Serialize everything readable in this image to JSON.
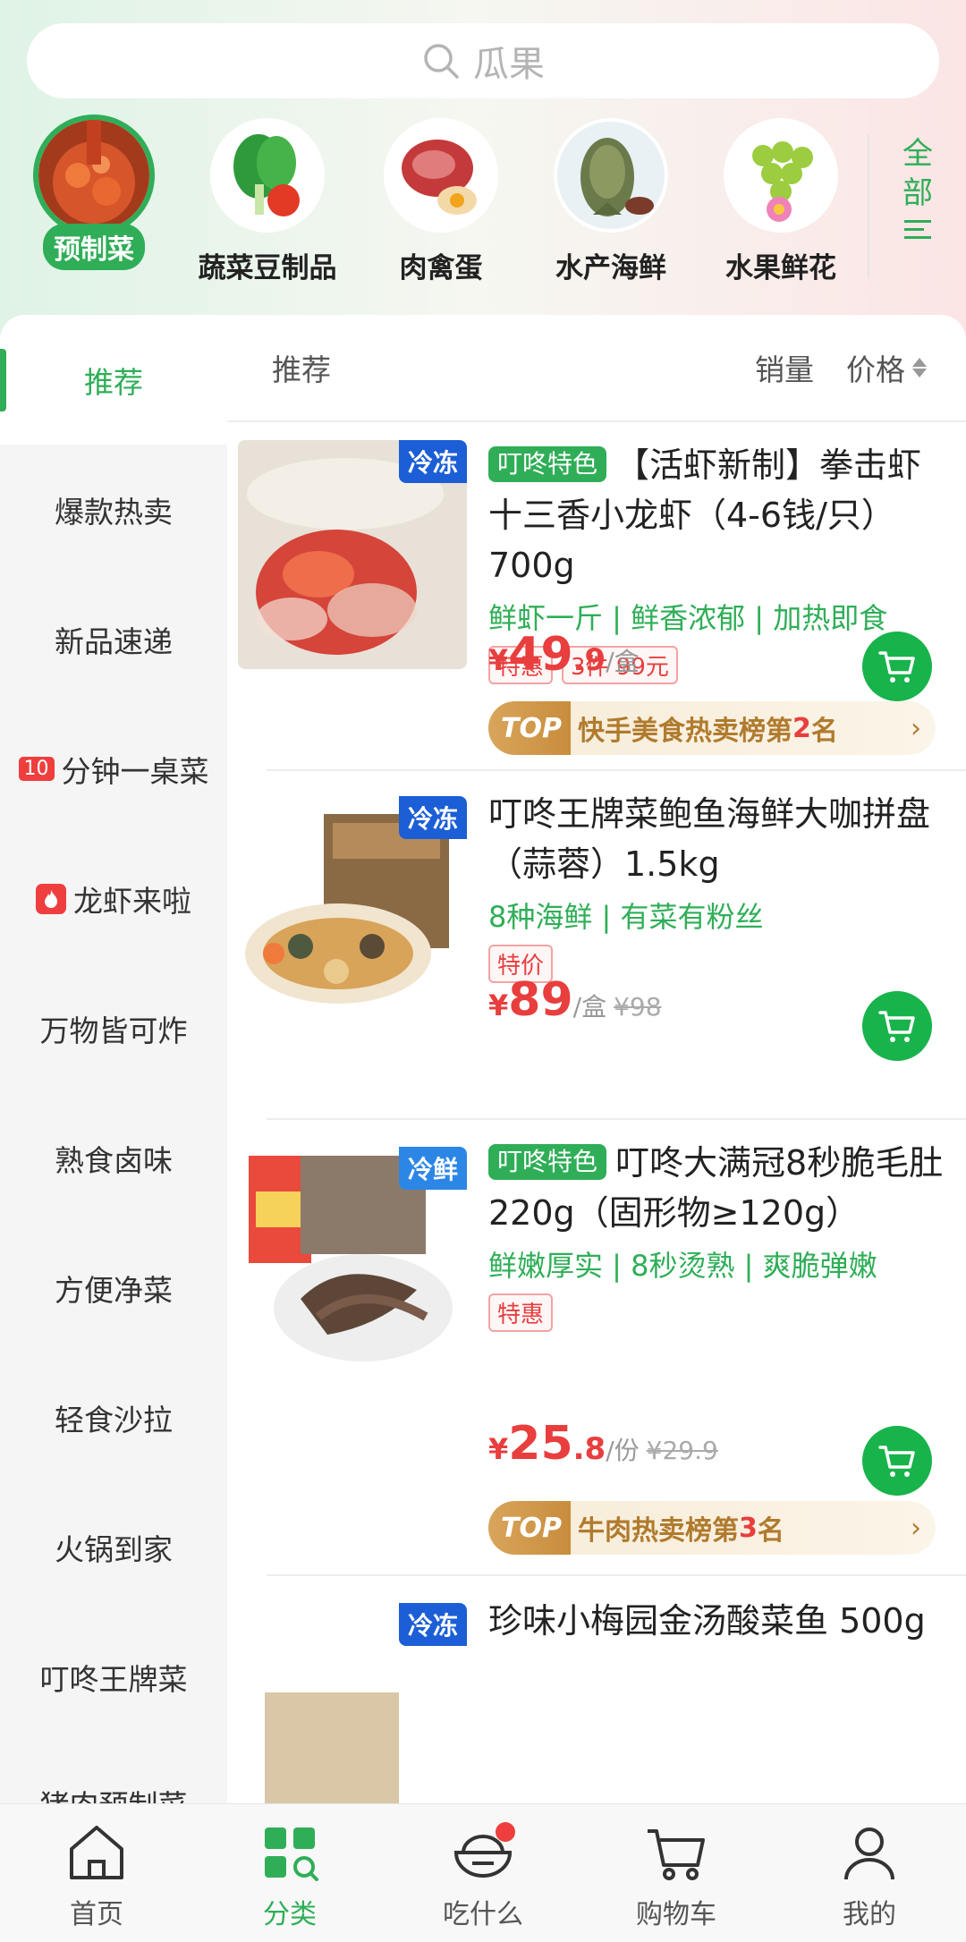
{
  "search": {
    "placeholder": "瓜果"
  },
  "categories": [
    {
      "label": "预制菜",
      "icon": "crayfish-dish-image",
      "active": true
    },
    {
      "label": "蔬菜豆制品",
      "icon": "vegetables-image"
    },
    {
      "label": "肉禽蛋",
      "icon": "meat-egg-image"
    },
    {
      "label": "水产海鲜",
      "icon": "fish-image"
    },
    {
      "label": "水果鲜花",
      "icon": "grapes-flower-image"
    }
  ],
  "all_button": {
    "chars": [
      "全",
      "部"
    ]
  },
  "sidebar": {
    "items": [
      {
        "label": "推荐"
      },
      {
        "label": "爆款热卖"
      },
      {
        "label": "新品速递"
      },
      {
        "label": "分钟一桌菜",
        "badge": "10"
      },
      {
        "label": "龙虾来啦",
        "badge_icon": "fire-icon"
      },
      {
        "label": "万物皆可炸"
      },
      {
        "label": "熟食卤味"
      },
      {
        "label": "方便净菜"
      },
      {
        "label": "轻食沙拉"
      },
      {
        "label": "火锅到家"
      },
      {
        "label": "叮咚王牌菜"
      },
      {
        "label": "猪肉预制菜"
      }
    ]
  },
  "list_header": {
    "recommend": "推荐",
    "sales": "销量",
    "price": "价格"
  },
  "products": [
    {
      "storage": "冷冻",
      "tag": "叮咚特色",
      "title": "【活虾新制】拳击虾十三香小龙虾（4-6钱/只） 700g",
      "subtitle": "鲜虾一斤 | 鲜香浓郁 | 加热即食",
      "promos": [
        "特惠",
        "3件 99元"
      ],
      "price_yen": "¥",
      "price_int": "49",
      "price_dec": ".9",
      "unit": "/盒",
      "original": "",
      "rank": {
        "badge": "TOP",
        "prefix": "快手美食热卖榜第",
        "num": "2",
        "suffix": "名"
      }
    },
    {
      "storage": "冷冻",
      "tag": "",
      "title": "叮咚王牌菜鲍鱼海鲜大咖拼盘（蒜蓉）1.5kg",
      "subtitle": "8种海鲜 | 有菜有粉丝",
      "promos": [
        "特价"
      ],
      "price_yen": "¥",
      "price_int": "89",
      "price_dec": "",
      "unit": "/盒",
      "original": "¥98"
    },
    {
      "storage": "冷鲜",
      "tag": "叮咚特色",
      "title": "叮咚大满冠8秒脆毛肚 220g（固形物≥120g）",
      "subtitle": "鲜嫩厚实 | 8秒烫熟 | 爽脆弹嫩",
      "promos": [
        "特惠"
      ],
      "price_yen": "¥",
      "price_int": "25",
      "price_dec": ".8",
      "unit": "/份",
      "original": "¥29.9",
      "rank": {
        "badge": "TOP",
        "prefix": "牛肉热卖榜第",
        "num": "3",
        "suffix": "名"
      }
    },
    {
      "storage": "冷冻",
      "tag": "",
      "title": "珍味小梅园金汤酸菜鱼 500g"
    }
  ],
  "bottom_nav": [
    {
      "label": "首页",
      "icon": "home-icon"
    },
    {
      "label": "分类",
      "icon": "category-icon",
      "active": true
    },
    {
      "label": "吃什么",
      "icon": "bowl-icon"
    },
    {
      "label": "购物车",
      "icon": "cart-icon"
    },
    {
      "label": "我的",
      "icon": "profile-icon"
    }
  ],
  "colors": {
    "brand_green": "#2fae57",
    "price_red": "#e83e3e",
    "frozen_blue": "#1b5ed6"
  }
}
